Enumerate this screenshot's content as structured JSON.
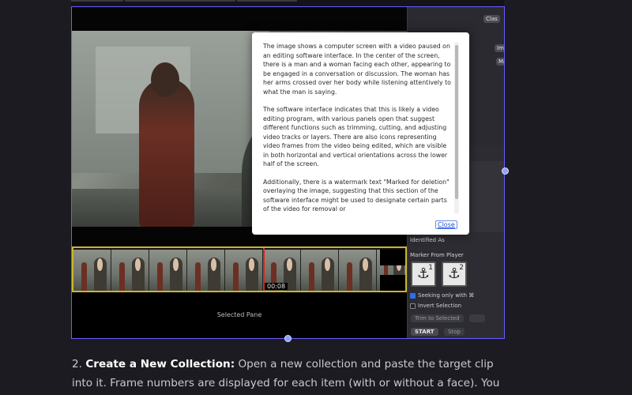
{
  "modal": {
    "paragraphs": [
      " The image shows a computer screen with a video paused on an editing software interface. In the center of the screen, there is a man and a woman facing each other, appearing to be engaged in a conversation or discussion. The woman has her arms crossed over her body while listening attentively to what the man is saying.",
      "The software interface indicates that this is likely a video editing program, with various panels open that suggest different functions such as trimming, cutting, and adjusting video tracks or layers. There are also icons representing video frames from the video being edited, which are visible in both horizontal and vertical orientations across the lower half of the screen.",
      "Additionally, there is a watermark text \"Marked for deletion\" overlaying the image, suggesting that this section of the software interface might be used to designate certain parts of the video for removal or"
    ],
    "close_label": "Close"
  },
  "editor": {
    "timecode": "00:08",
    "selected_pane_label": "Selected Pane",
    "side_panel": {
      "pill_top": "Clas",
      "pill_2": "Ima",
      "pill_3": "Ma",
      "identified_as": "Identified As",
      "marker_from_player": "Marker From Player",
      "anchor_1_number": "1",
      "anchor_2_number": "2",
      "seeking_only_with": "Seeking only with ⌘",
      "invert_selection": "Invert Selection",
      "trim_to_selected": "Trim to Selected",
      "start_label": "START",
      "stop_label": "Stop"
    }
  },
  "article": {
    "step_number": "2.",
    "step_title": "Create a New Collection:",
    "step_text": " Open a new collection and paste the target clip into it. Frame numbers are displayed for each item (with or without a face). You may"
  },
  "colors": {
    "page_bg": "#1b1b21",
    "selection_border": "#6a5cff",
    "timeline_border": "#c9b82a",
    "playhead": "#e0261c",
    "link": "#1a4fd0"
  },
  "icons": [
    "anchor-icon",
    "checkbox-icon"
  ]
}
